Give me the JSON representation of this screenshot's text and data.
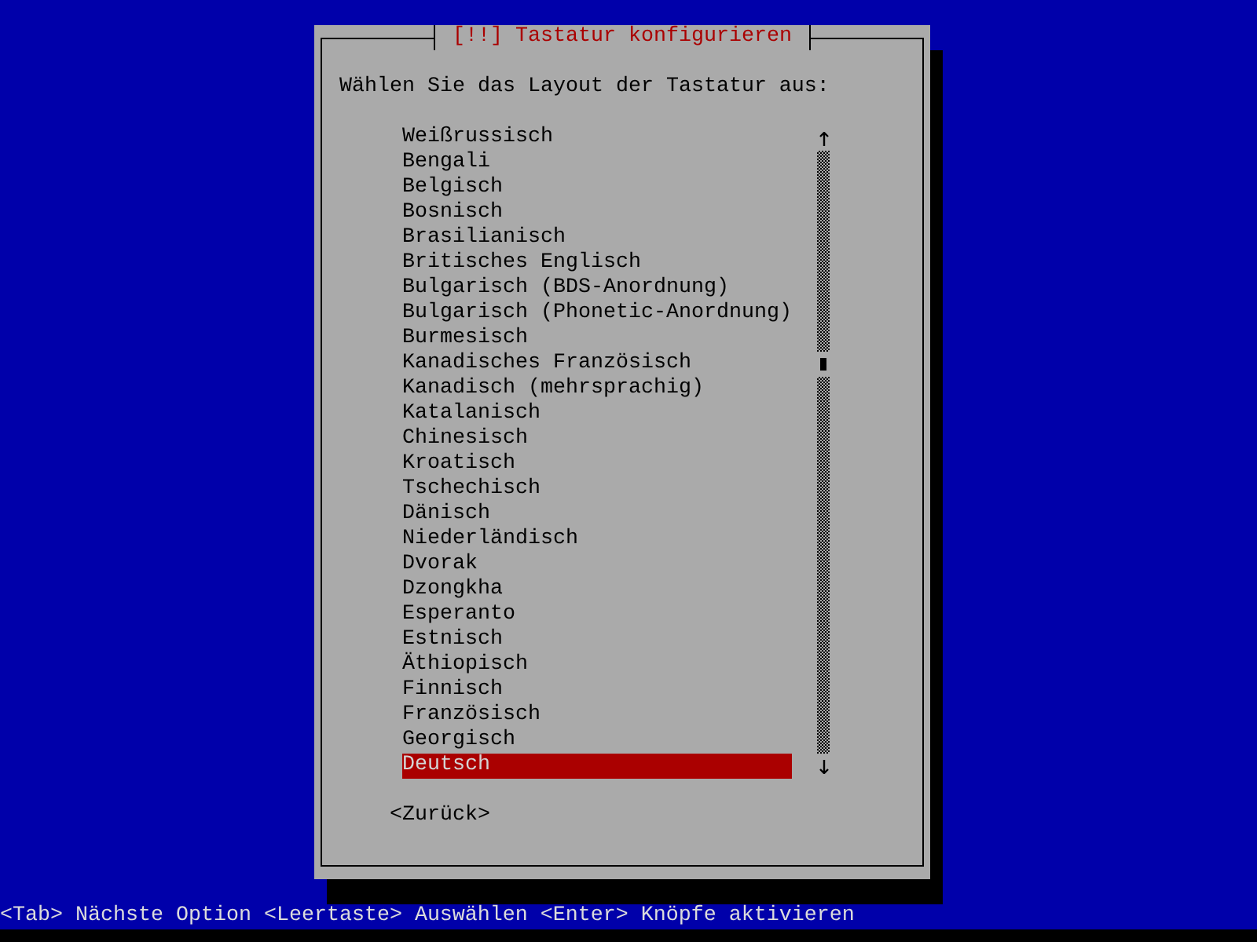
{
  "dialog": {
    "title": "[!!] Tastatur konfigurieren",
    "prompt": "Wählen Sie das Layout der Tastatur aus:",
    "options": [
      {
        "label": "Weißrussisch",
        "selected": false
      },
      {
        "label": "Bengali",
        "selected": false
      },
      {
        "label": "Belgisch",
        "selected": false
      },
      {
        "label": "Bosnisch",
        "selected": false
      },
      {
        "label": "Brasilianisch",
        "selected": false
      },
      {
        "label": "Britisches Englisch",
        "selected": false
      },
      {
        "label": "Bulgarisch (BDS-Anordnung)",
        "selected": false
      },
      {
        "label": "Bulgarisch (Phonetic-Anordnung)",
        "selected": false
      },
      {
        "label": "Burmesisch",
        "selected": false
      },
      {
        "label": "Kanadisches Französisch",
        "selected": false
      },
      {
        "label": "Kanadisch (mehrsprachig)",
        "selected": false
      },
      {
        "label": "Katalanisch",
        "selected": false
      },
      {
        "label": "Chinesisch",
        "selected": false
      },
      {
        "label": "Kroatisch",
        "selected": false
      },
      {
        "label": "Tschechisch",
        "selected": false
      },
      {
        "label": "Dänisch",
        "selected": false
      },
      {
        "label": "Niederländisch",
        "selected": false
      },
      {
        "label": "Dvorak",
        "selected": false
      },
      {
        "label": "Dzongkha",
        "selected": false
      },
      {
        "label": "Esperanto",
        "selected": false
      },
      {
        "label": "Estnisch",
        "selected": false
      },
      {
        "label": "Äthiopisch",
        "selected": false
      },
      {
        "label": "Finnisch",
        "selected": false
      },
      {
        "label": "Französisch",
        "selected": false
      },
      {
        "label": "Georgisch",
        "selected": false
      },
      {
        "label": "Deutsch",
        "selected": true
      }
    ],
    "buttons": [
      {
        "label": "<Zurück>"
      }
    ]
  },
  "status_bar": "<Tab> Nächste Option <Leertaste> Auswählen <Enter> Knöpfe aktivieren"
}
